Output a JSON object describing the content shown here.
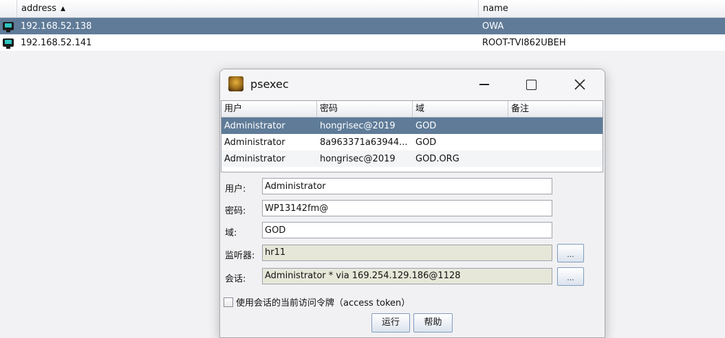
{
  "background_table": {
    "columns": {
      "address": "address",
      "name": "name"
    },
    "rows": [
      {
        "address": "192.168.52.138",
        "name": "OWA",
        "selected": true
      },
      {
        "address": "192.168.52.141",
        "name": "ROOT-TVI862UBEH",
        "selected": false
      }
    ]
  },
  "dialog": {
    "title": "psexec",
    "table": {
      "headers": [
        "用户",
        "密码",
        "域",
        "备注"
      ],
      "rows": [
        {
          "user": "Administrator",
          "password": "hongrisec@2019",
          "domain": "GOD",
          "note": "",
          "selected": true
        },
        {
          "user": "Administrator",
          "password": "8a963371a63944...",
          "domain": "GOD",
          "note": "",
          "selected": false
        },
        {
          "user": "Administrator",
          "password": "hongrisec@2019",
          "domain": "GOD.ORG",
          "note": "",
          "selected": false
        }
      ]
    },
    "form": {
      "user_label": "用户:",
      "user_value": "Administrator",
      "password_label": "密码:",
      "password_value": "WP13142fm@",
      "domain_label": "域:",
      "domain_value": "GOD",
      "listener_label": "监听器:",
      "listener_value": "hr11",
      "session_label": "会话:",
      "session_value": "Administrator * via  169.254.129.186@1128",
      "browse_label": "...",
      "token_checkbox_label": "使用会话的当前访问令牌（access token）"
    },
    "buttons": {
      "run": "运行",
      "help": "帮助"
    }
  },
  "colors": {
    "selection": "#5f7b98",
    "readonly_field": "#e6e7d8"
  }
}
